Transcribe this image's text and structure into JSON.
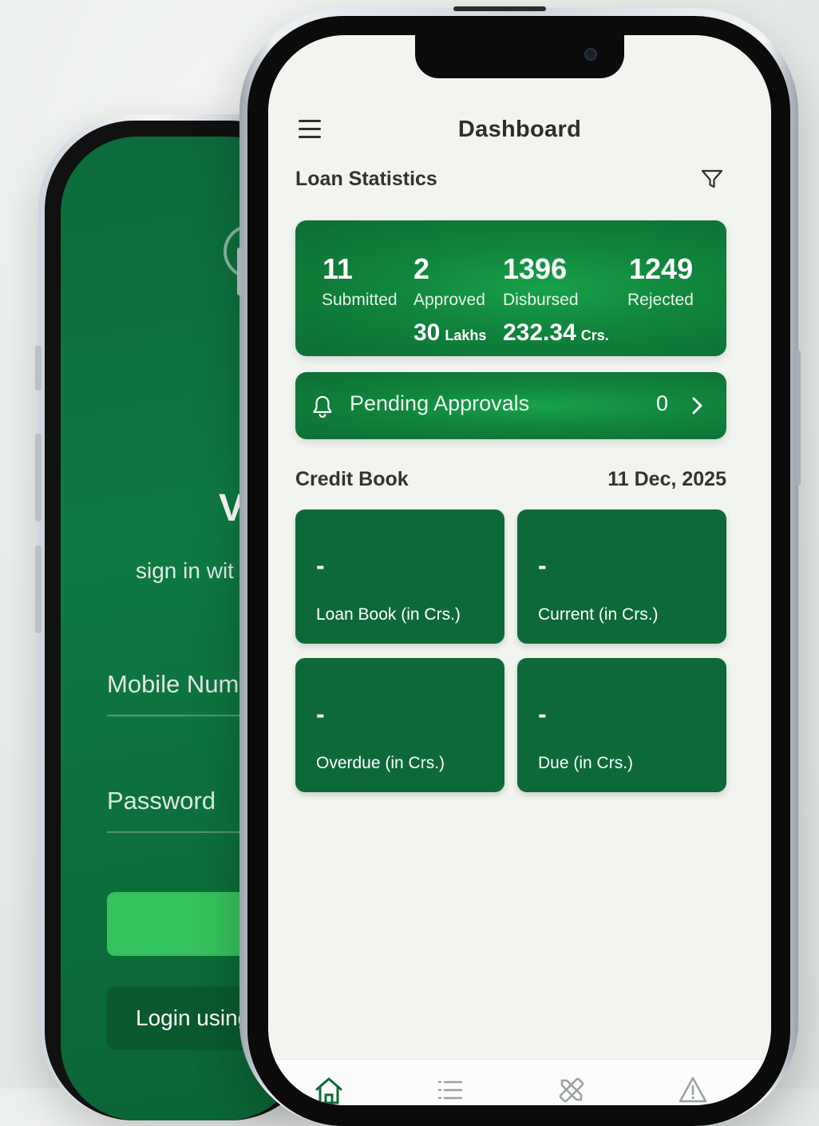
{
  "login_screen": {
    "subtitle_fragment": "sign in wit",
    "mobile_placeholder_fragment": "Mobile Num",
    "password_placeholder": "Password",
    "alt_login_fragment": "Login using",
    "header_fragment": "V"
  },
  "dashboard": {
    "title": "Dashboard",
    "loan_statistics": {
      "title": "Loan Statistics",
      "stats": [
        {
          "count": "11",
          "label": "Submitted"
        },
        {
          "count": "2",
          "label": "Approved",
          "amount": "30",
          "unit": "Lakhs"
        },
        {
          "count": "1396",
          "label": "Disbursed",
          "amount": "232.34",
          "unit": "Crs."
        },
        {
          "count": "1249",
          "label": "Rejected"
        }
      ]
    },
    "pending": {
      "label": "Pending Approvals",
      "count": "0"
    },
    "credit_book": {
      "title": "Credit Book",
      "date": "11 Dec, 2025",
      "tiles": [
        {
          "value": "-",
          "label": "Loan Book (in Crs.)"
        },
        {
          "value": "-",
          "label": "Current (in Crs.)"
        },
        {
          "value": "-",
          "label": "Overdue (in Crs.)"
        },
        {
          "value": "-",
          "label": "Due (in Crs.)"
        }
      ]
    },
    "bottom_nav": [
      "home-icon",
      "list-icon",
      "tools-icon",
      "alert-icon"
    ]
  },
  "colors": {
    "primary_green": "#0d6a38",
    "accent_green": "#18a24a",
    "login_button_green": "#35c15c",
    "screen_bg": "#f2f4ef"
  }
}
